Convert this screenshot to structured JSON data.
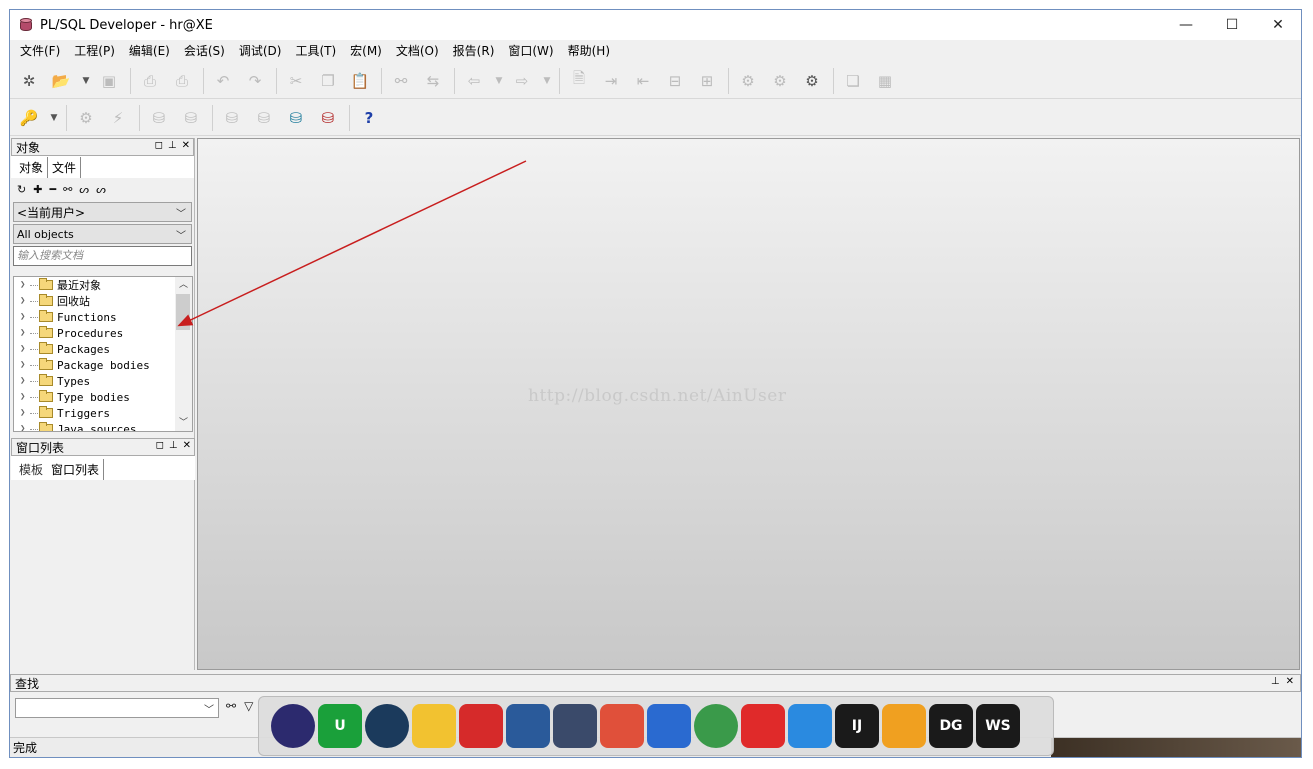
{
  "window": {
    "title": "PL/SQL Developer - hr@XE"
  },
  "controls": {
    "minimize": "—",
    "maximize": "☐",
    "close": "✕"
  },
  "menu": [
    "文件(F)",
    "工程(P)",
    "编辑(E)",
    "会话(S)",
    "调试(D)",
    "工具(T)",
    "宏(M)",
    "文档(O)",
    "报告(R)",
    "窗口(W)",
    "帮助(H)"
  ],
  "object_panel": {
    "title": "对象",
    "tabs": [
      "对象",
      "文件"
    ],
    "user_select": "<当前用户>",
    "filter_select": "All objects",
    "search_placeholder": "输入搜索文档",
    "tree": [
      "最近对象",
      "回收站",
      "Functions",
      "Procedures",
      "Packages",
      "Package bodies",
      "Types",
      "Type bodies",
      "Triggers",
      "Java sources"
    ]
  },
  "window_list_panel": {
    "title": "窗口列表",
    "tabs": [
      "模板",
      "窗口列表"
    ]
  },
  "find_panel": {
    "title": "查找"
  },
  "status": {
    "text": "完成"
  },
  "watermark": "http://blog.csdn.net/AinUser",
  "dock_apps": [
    {
      "name": "eclipse",
      "label": "",
      "color": "#2c2a6e"
    },
    {
      "name": "intellij-upsource",
      "label": "U",
      "color": "#1aa03a"
    },
    {
      "name": "steam",
      "label": "",
      "color": "#1b3a5c"
    },
    {
      "name": "bear-app",
      "label": "",
      "color": "#f2c230"
    },
    {
      "name": "redis-desktop",
      "label": "",
      "color": "#d62a2a"
    },
    {
      "name": "virtualbox",
      "label": "",
      "color": "#2a5a9a"
    },
    {
      "name": "plsql-developer",
      "label": "",
      "color": "#3a4a6a"
    },
    {
      "name": "git",
      "label": "",
      "color": "#e0503a"
    },
    {
      "name": "vpn-lock",
      "label": "",
      "color": "#2a6ad0"
    },
    {
      "name": "chrome",
      "label": "",
      "color": "#3a9a4a"
    },
    {
      "name": "netease-music",
      "label": "",
      "color": "#e02a2a"
    },
    {
      "name": "dingtalk",
      "label": "",
      "color": "#2a8ae0"
    },
    {
      "name": "intellij-idea",
      "label": "IJ",
      "color": "#1a1a1a"
    },
    {
      "name": "folder-app",
      "label": "",
      "color": "#f0a020"
    },
    {
      "name": "datagrip",
      "label": "DG",
      "color": "#1a1a1a"
    },
    {
      "name": "webstorm",
      "label": "WS",
      "color": "#1a1a1a"
    }
  ]
}
